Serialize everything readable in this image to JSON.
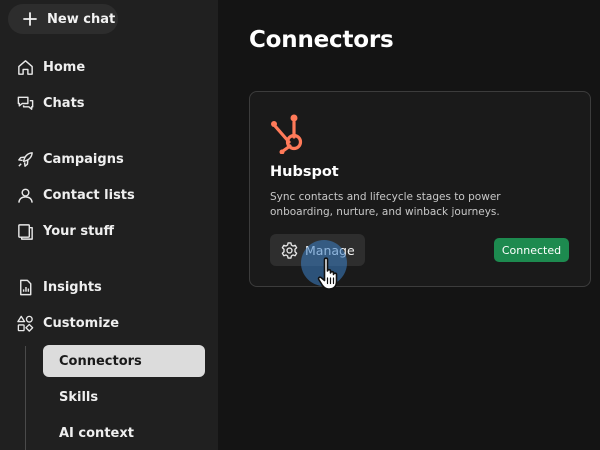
{
  "sidebar": {
    "new_chat_label": "New chat",
    "items": [
      {
        "label": "Home",
        "icon": "home-icon"
      },
      {
        "label": "Chats",
        "icon": "chat-bubbles-icon"
      },
      {
        "label": "Campaigns",
        "icon": "rocket-icon"
      },
      {
        "label": "Contact lists",
        "icon": "contacts-icon"
      },
      {
        "label": "Your stuff",
        "icon": "file-stack-icon"
      },
      {
        "label": "Insights",
        "icon": "report-icon"
      },
      {
        "label": "Customize",
        "icon": "shapes-icon"
      }
    ],
    "sub_items": [
      {
        "label": "Connectors",
        "active": true
      },
      {
        "label": "Skills",
        "active": false
      },
      {
        "label": "AI context",
        "active": false
      }
    ]
  },
  "main": {
    "title": "Connectors",
    "connector": {
      "name": "Hubspot",
      "logo_icon": "hubspot-logo",
      "description": "Sync contacts and lifecycle stages to power onboarding, nurture, and winback journeys.",
      "manage_label": "Manage",
      "status": "Connected"
    }
  },
  "colors": {
    "sidebar_bg": "#202020",
    "main_bg": "#141414",
    "hubspot_orange": "#ff7a59",
    "connected_green": "#1d8a4f",
    "active_item_bg": "#dcdcdc"
  }
}
